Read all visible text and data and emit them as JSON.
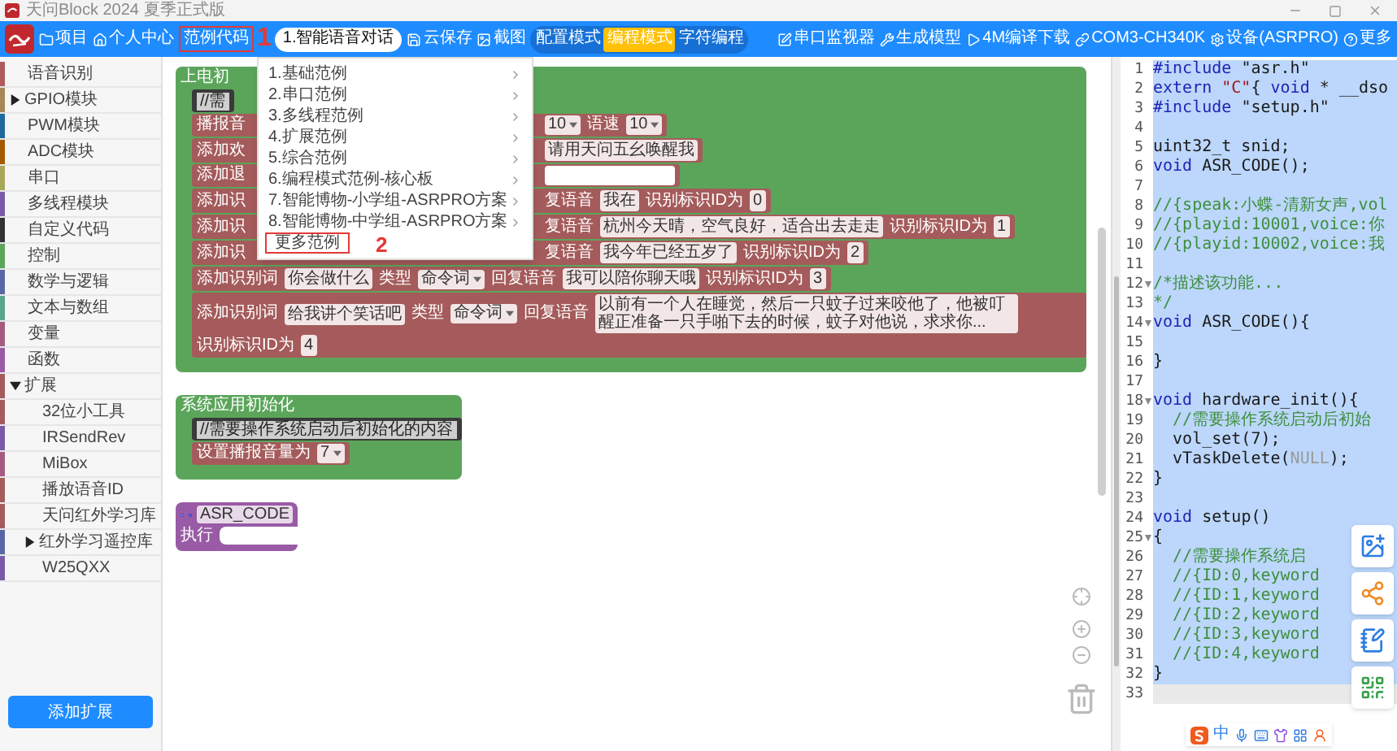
{
  "window": {
    "title": "天问Block 2024 夏季正式版"
  },
  "toolbar": {
    "nav": [
      {
        "label": "项目"
      },
      {
        "label": "个人中心"
      }
    ],
    "examples_button": {
      "label": "范例代码",
      "outlined": true
    },
    "annotation": "1",
    "example_field": {
      "value": "1.智能语音对话"
    },
    "actions": [
      {
        "label": "云保存"
      },
      {
        "label": "截图"
      }
    ],
    "modes": [
      {
        "label": "配置模式",
        "selected": false
      },
      {
        "label": "编程模式",
        "selected": true
      },
      {
        "label": "字符编程",
        "selected": false
      }
    ],
    "right": [
      {
        "label": "串口监视器"
      },
      {
        "label": "生成模型"
      },
      {
        "label": "4M编译下载"
      },
      {
        "label": "COM3-CH340K"
      },
      {
        "label": "设备(ASRPRO)"
      },
      {
        "label": "更多"
      }
    ]
  },
  "sidebar": {
    "items": [
      {
        "label": "语音识别",
        "color": "#b05c5c"
      },
      {
        "label": "GPIO模块",
        "color": "#a8875a",
        "expanded": false
      },
      {
        "label": "PWM模块",
        "color": "#1f6a9a"
      },
      {
        "label": "ADC模块",
        "color": "#a65a00"
      },
      {
        "label": "串口",
        "color": "#a8a85a"
      },
      {
        "label": "多线程模块",
        "color": "#7a5ba6"
      },
      {
        "label": "自定义代码",
        "color": "#333333"
      },
      {
        "label": "控制",
        "color": "#5ba55b"
      },
      {
        "label": "数学与逻辑",
        "color": "#5b67a5"
      },
      {
        "label": "文本与数组",
        "color": "#5ba58c"
      },
      {
        "label": "变量",
        "color": "#a55b80"
      },
      {
        "label": "函数",
        "color": "#995ba5"
      },
      {
        "label": "扩展",
        "color": "#a55b5b",
        "expanded": true,
        "children": [
          {
            "label": "32位小工具",
            "color": "#a55b5b"
          },
          {
            "label": "IRSendRev",
            "color": "#7a5ba6"
          },
          {
            "label": "MiBox",
            "color": "#a55b80"
          },
          {
            "label": "播放语音ID",
            "color": "#a55b5b"
          },
          {
            "label": "天问红外学习库",
            "color": "#a55b5b"
          },
          {
            "label": "红外学习遥控库",
            "color": "#5b67a5",
            "expanded": false
          },
          {
            "label": "W25QXX",
            "color": "#7a5ba6"
          }
        ]
      }
    ],
    "add_button": "添加扩展"
  },
  "canvas": {
    "blocks": [
      {
        "kind": "event",
        "header": "上电初",
        "comment": "//需",
        "rows": [
          {
            "lead": "播报音",
            "parts": [
              {
                "kind": "dropdown",
                "text": "10"
              },
              {
                "kind": "label",
                "text": "语速"
              },
              {
                "kind": "dropdown",
                "text": "10"
              }
            ]
          },
          {
            "lead": "添加欢",
            "parts": [
              {
                "kind": "field",
                "text": "请用天问五幺唤醒我"
              }
            ]
          },
          {
            "lead": "添加退",
            "parts": [
              {
                "kind": "blank"
              }
            ]
          },
          {
            "lead": "添加识",
            "parts": [
              {
                "kind": "label",
                "text": "复语音"
              },
              {
                "kind": "field",
                "text": "我在"
              },
              {
                "kind": "label",
                "text": "识别标识ID为"
              },
              {
                "kind": "field",
                "text": "0"
              }
            ]
          },
          {
            "lead": "添加识",
            "parts": [
              {
                "kind": "label",
                "text": "复语音"
              },
              {
                "kind": "field",
                "text": "杭州今天晴，空气良好，适合出去走走"
              },
              {
                "kind": "label",
                "text": "识别标识ID为"
              },
              {
                "kind": "field",
                "text": "1"
              }
            ]
          },
          {
            "lead": "添加识",
            "parts": [
              {
                "kind": "label",
                "text": "复语音"
              },
              {
                "kind": "field",
                "text": "我今年已经五岁了"
              },
              {
                "kind": "label",
                "text": "识别标识ID为"
              },
              {
                "kind": "field",
                "text": "2"
              }
            ]
          },
          {
            "parts": [
              {
                "kind": "label",
                "text": "添加识别词"
              },
              {
                "kind": "field",
                "text": "你会做什么"
              },
              {
                "kind": "label",
                "text": "类型"
              },
              {
                "kind": "dropdown",
                "text": "命令词"
              },
              {
                "kind": "label",
                "text": "回复语音"
              },
              {
                "kind": "field",
                "text": "我可以陪你聊天哦"
              },
              {
                "kind": "label",
                "text": "识别标识ID为"
              },
              {
                "kind": "field",
                "text": "3"
              }
            ]
          },
          {
            "parts": [
              {
                "kind": "label",
                "text": "添加识别词"
              },
              {
                "kind": "field",
                "text": "给我讲个笑话吧"
              },
              {
                "kind": "label",
                "text": "类型"
              },
              {
                "kind": "dropdown",
                "text": "命令词"
              },
              {
                "kind": "label",
                "text": "回复语音"
              },
              {
                "kind": "field",
                "text": "以前有一个人在睡觉，然后一只蚊子过来咬他了，他被叮醒正准备一只手啪下去的时候，蚊子对他说，求求你..."
              },
              {
                "kind": "label",
                "text": "识别标识ID为"
              },
              {
                "kind": "field",
                "text": "4"
              }
            ]
          }
        ]
      },
      {
        "kind": "event",
        "header": "系统应用初始化",
        "comment": "//需要操作系统启动后初始化的内容",
        "rows": [
          {
            "parts": [
              {
                "kind": "label",
                "text": "设置播报音量为"
              },
              {
                "kind": "dropdown",
                "text": "7"
              }
            ]
          }
        ]
      },
      {
        "kind": "function",
        "name": "ASR_CODE",
        "label": "执行"
      }
    ]
  },
  "examples_menu": {
    "items": [
      {
        "label": "1.基础范例",
        "submenu": true,
        "outlined": false
      },
      {
        "label": "2.串口范例",
        "submenu": true,
        "outlined": false
      },
      {
        "label": "3.多线程范例",
        "submenu": true,
        "outlined": false
      },
      {
        "label": "4.扩展范例",
        "submenu": true,
        "outlined": false
      },
      {
        "label": "5.综合范例",
        "submenu": true,
        "outlined": false
      },
      {
        "label": "6.编程模式范例-核心板",
        "submenu": true,
        "outlined": false
      },
      {
        "label": "7.智能博物-小学组-ASRPRO方案",
        "submenu": true,
        "outlined": false
      },
      {
        "label": "8.智能博物-中学组-ASRPRO方案",
        "submenu": true,
        "outlined": false
      },
      {
        "label": "更多范例",
        "submenu": false,
        "outlined": true
      }
    ],
    "annotation": "2"
  },
  "editor": {
    "lines": [
      {
        "n": "1",
        "selected": true,
        "tokens": [
          {
            "kind": "keyword",
            "text": "#include"
          },
          {
            "kind": "plain",
            "text": " \"asr.h\""
          }
        ]
      },
      {
        "n": "2",
        "selected": true,
        "tokens": [
          {
            "kind": "keyword",
            "text": "extern"
          },
          {
            "kind": "string",
            "text": " \"C\""
          },
          {
            "kind": "plain",
            "text": "{ "
          },
          {
            "kind": "keyword",
            "text": "void"
          },
          {
            "kind": "plain",
            "text": " * __dso"
          }
        ]
      },
      {
        "n": "3",
        "selected": true,
        "tokens": [
          {
            "kind": "keyword",
            "text": "#include"
          },
          {
            "kind": "plain",
            "text": " \"setup.h\""
          }
        ]
      },
      {
        "n": "4",
        "selected": true
      },
      {
        "n": "5",
        "selected": true,
        "tokens": [
          {
            "kind": "plain",
            "text": "uint32_t snid;"
          }
        ]
      },
      {
        "n": "6",
        "selected": true,
        "tokens": [
          {
            "kind": "keyword",
            "text": "void"
          },
          {
            "kind": "plain",
            "text": " ASR_CODE();"
          }
        ]
      },
      {
        "n": "7",
        "selected": true
      },
      {
        "n": "8",
        "selected": true,
        "tokens": [
          {
            "kind": "comment",
            "text": "//{speak:小蝶-清新女声,vol"
          }
        ]
      },
      {
        "n": "9",
        "selected": true,
        "tokens": [
          {
            "kind": "comment",
            "text": "//{playid:10001,voice:你"
          }
        ]
      },
      {
        "n": "10",
        "selected": true,
        "tokens": [
          {
            "kind": "comment",
            "text": "//{playid:10002,voice:我"
          }
        ]
      },
      {
        "n": "11",
        "selected": true
      },
      {
        "n": "12",
        "selected": true,
        "fold": true,
        "tokens": [
          {
            "kind": "comment",
            "text": "/*描述该功能..."
          }
        ]
      },
      {
        "n": "13",
        "selected": true,
        "tokens": [
          {
            "kind": "comment",
            "text": "*/"
          }
        ]
      },
      {
        "n": "14",
        "selected": true,
        "fold": true,
        "tokens": [
          {
            "kind": "keyword",
            "text": "void"
          },
          {
            "kind": "plain",
            "text": " ASR_CODE(){"
          }
        ]
      },
      {
        "n": "15",
        "selected": true
      },
      {
        "n": "16",
        "selected": true,
        "tokens": [
          {
            "kind": "plain",
            "text": "}"
          }
        ]
      },
      {
        "n": "17",
        "selected": true
      },
      {
        "n": "18",
        "selected": true,
        "fold": true,
        "tokens": [
          {
            "kind": "keyword",
            "text": "void"
          },
          {
            "kind": "plain",
            "text": " hardware_init(){"
          }
        ]
      },
      {
        "n": "19",
        "selected": true,
        "tokens": [
          {
            "kind": "comment",
            "text": "  //需要操作系统启动后初始"
          }
        ]
      },
      {
        "n": "20",
        "selected": true,
        "tokens": [
          {
            "kind": "plain",
            "text": "  vol_set(7);"
          }
        ]
      },
      {
        "n": "21",
        "selected": true,
        "tokens": [
          {
            "kind": "plain",
            "text": "  vTaskDelete("
          },
          {
            "kind": "constant",
            "text": "NULL"
          },
          {
            "kind": "plain",
            "text": ");"
          }
        ]
      },
      {
        "n": "22",
        "selected": true,
        "tokens": [
          {
            "kind": "plain",
            "text": "}"
          }
        ]
      },
      {
        "n": "23",
        "selected": true
      },
      {
        "n": "24",
        "selected": true,
        "tokens": [
          {
            "kind": "keyword",
            "text": "void"
          },
          {
            "kind": "plain",
            "text": " setup()"
          }
        ]
      },
      {
        "n": "25",
        "selected": true,
        "fold": true,
        "tokens": [
          {
            "kind": "plain",
            "text": "{"
          }
        ]
      },
      {
        "n": "26",
        "selected": true,
        "tokens": [
          {
            "kind": "comment",
            "text": "  //需要操作系统启"
          }
        ]
      },
      {
        "n": "27",
        "selected": true,
        "tokens": [
          {
            "kind": "comment",
            "text": "  //{ID:0,keyword"
          }
        ]
      },
      {
        "n": "28",
        "selected": true,
        "tokens": [
          {
            "kind": "comment",
            "text": "  //{ID:1,keyword"
          }
        ]
      },
      {
        "n": "29",
        "selected": true,
        "tokens": [
          {
            "kind": "comment",
            "text": "  //{ID:2,keyword"
          }
        ]
      },
      {
        "n": "30",
        "selected": true,
        "tokens": [
          {
            "kind": "comment",
            "text": "  //{ID:3,keyword"
          }
        ]
      },
      {
        "n": "31",
        "selected": true,
        "tokens": [
          {
            "kind": "comment",
            "text": "  //{ID:4,keyword"
          }
        ]
      },
      {
        "n": "32",
        "selected": true,
        "tokens": [
          {
            "kind": "plain",
            "text": "}"
          }
        ]
      },
      {
        "n": "33",
        "selected": false
      }
    ]
  },
  "ime_bar": {
    "mode": "中"
  }
}
